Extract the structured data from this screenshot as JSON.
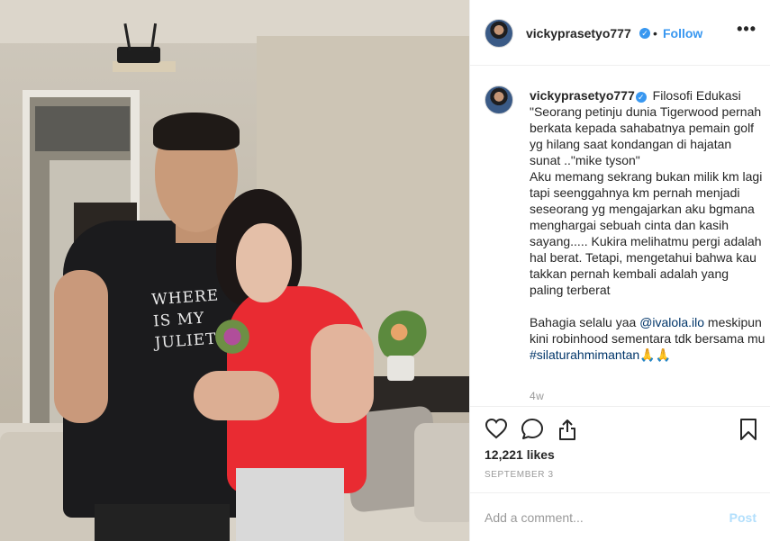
{
  "post": {
    "username": "vickyprasetyo777",
    "verified_mark": "✓",
    "dot": "•",
    "follow_label": "Follow",
    "more_label": "•••",
    "caption": {
      "username": "vickyprasetyo777",
      "lines": [
        "Filosofi Edukasi",
        "\"Seorang petinju dunia Tigerwood pernah berkata kepada sahabatnya pemain golf yg hilang saat kondangan di hajatan sunat ..\"mike tyson\"",
        "Aku memang sekrang bukan milik km lagi tapi seenggahnya km pernah menjadi seseorang yg mengajarkan aku bgmana menghargai sebuah cinta dan kasih sayang..... Kukira melihatmu pergi adalah hal berat. Tetapi, mengetahui bahwa kau takkan pernah kembali adalah yang paling terberat"
      ],
      "para2_text": "Bahagia selalu yaa ",
      "mention": "@ivalola.ilo",
      "para2_rest": " meskipun kini robinhood sementara tdk bersama mu",
      "hashtag": "#silaturahmimantan",
      "emoji": "🙏🙏",
      "age": "4w"
    },
    "likes": "12,221 likes",
    "date": "SEPTEMBER 3",
    "comment_placeholder": "Add a comment...",
    "post_label": "Post",
    "photo_shirt_text": "WHERE IS MY JULIET"
  },
  "colors": {
    "accent": "#3897f0",
    "post_disabled": "#b2dffc",
    "link": "#003569"
  },
  "icons": [
    "heart-icon",
    "comment-icon",
    "share-icon",
    "bookmark-icon",
    "verified-icon"
  ]
}
